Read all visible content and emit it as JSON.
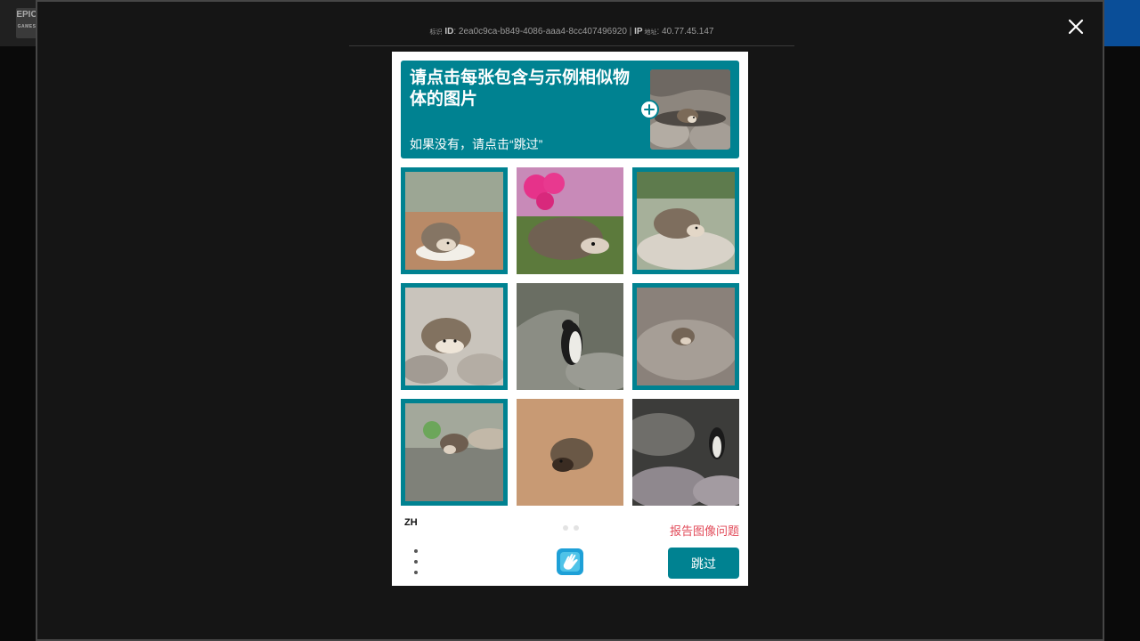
{
  "site": {
    "logo_text": "EPIC",
    "logo_sub": "GAMES"
  },
  "modal": {
    "info": {
      "id_prefix": "标识",
      "id_label": "ID",
      "id_value": ": 2ea0c9ca-b849-4086-aaa4-8cc407496920 | ",
      "ip_label": "IP",
      "ip_prefix": " 地址",
      "ip_value": ": 40.77.45.147"
    },
    "close_icon": "close-icon"
  },
  "captcha": {
    "prompt_title": "请点击每张包含与示例相似物体的图片",
    "prompt_sub": "如果没有，请点击“跳过”",
    "example_image": "hedgehog among rocks",
    "cells": [
      {
        "subject": "hedgehog in bowl",
        "selected": true
      },
      {
        "subject": "hedgehog with pink flower",
        "selected": false
      },
      {
        "subject": "hedgehog on rock",
        "selected": true
      },
      {
        "subject": "hedgehog on pebbles",
        "selected": true
      },
      {
        "subject": "penguin on rocks",
        "selected": false
      },
      {
        "subject": "small hedgehog on rock",
        "selected": true
      },
      {
        "subject": "hedgehog near pebbles",
        "selected": true
      },
      {
        "subject": "hedgehog on sand",
        "selected": false
      },
      {
        "subject": "penguin among rocks",
        "selected": false
      }
    ],
    "language": "ZH",
    "report_label": "报告图像问题",
    "submit_label": "跳过",
    "colors": {
      "accent": "#008291",
      "report": "#e24b5a"
    }
  }
}
